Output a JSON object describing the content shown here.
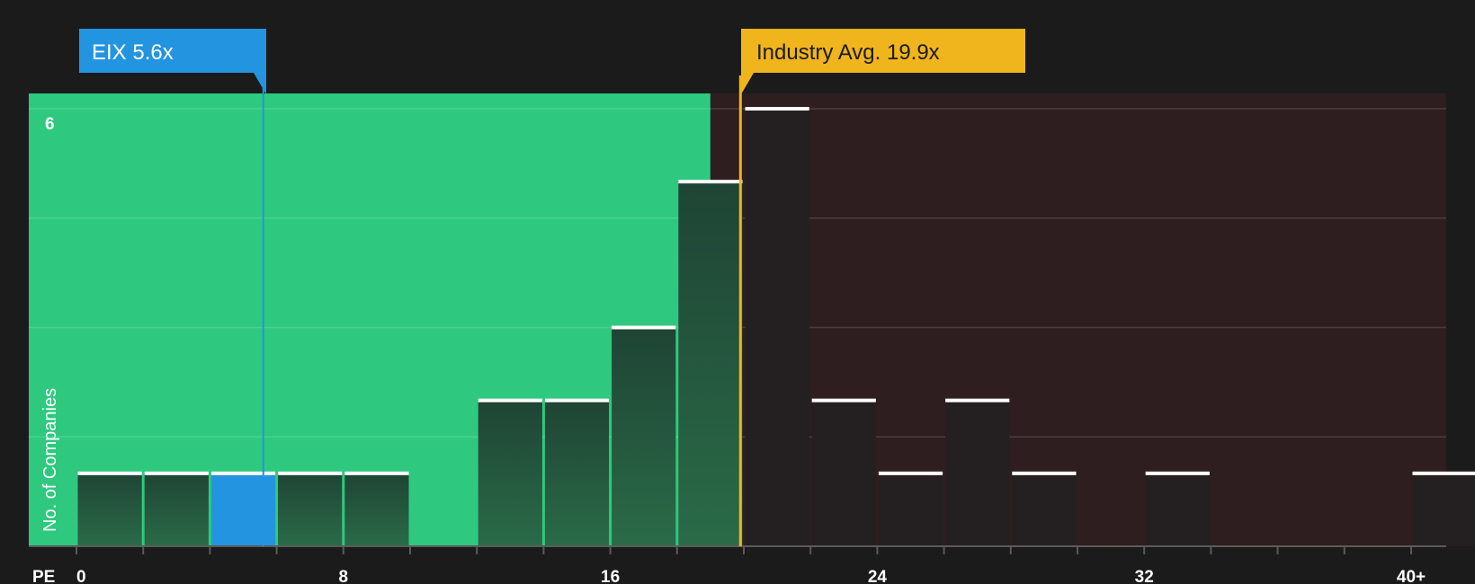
{
  "chart_data": {
    "type": "bar",
    "xlabel": "PE",
    "ylabel": "No. of Companies",
    "xlim": [
      0,
      41
    ],
    "ylim": [
      0,
      6.2
    ],
    "x_tick_labels": [
      {
        "x": 0,
        "label": "0"
      },
      {
        "x": 8,
        "label": "8"
      },
      {
        "x": 16,
        "label": "16"
      },
      {
        "x": 24,
        "label": "24"
      },
      {
        "x": 32,
        "label": "32"
      },
      {
        "x": 40,
        "label": "40+"
      }
    ],
    "minor_ticks": [
      0,
      2,
      4,
      6,
      8,
      10,
      12,
      14,
      16,
      18,
      20,
      22,
      24,
      26,
      28,
      30,
      32,
      34,
      36,
      38,
      40
    ],
    "y_ticks": [
      6
    ],
    "gridlines": [
      1.5,
      3,
      4.5,
      6
    ],
    "bins": [
      {
        "x0": 0,
        "x1": 2,
        "count": 1
      },
      {
        "x0": 2,
        "x1": 4,
        "count": 1
      },
      {
        "x0": 4,
        "x1": 6,
        "count": 1,
        "highlight": true
      },
      {
        "x0": 6,
        "x1": 8,
        "count": 1
      },
      {
        "x0": 8,
        "x1": 10,
        "count": 1
      },
      {
        "x0": 12,
        "x1": 14,
        "count": 2
      },
      {
        "x0": 14,
        "x1": 16,
        "count": 2
      },
      {
        "x0": 16,
        "x1": 18,
        "count": 3
      },
      {
        "x0": 18,
        "x1": 20,
        "count": 5
      },
      {
        "x0": 20,
        "x1": 22,
        "count": 6
      },
      {
        "x0": 22,
        "x1": 24,
        "count": 2
      },
      {
        "x0": 24,
        "x1": 26,
        "count": 1
      },
      {
        "x0": 26,
        "x1": 28,
        "count": 2
      },
      {
        "x0": 28,
        "x1": 30,
        "count": 1
      },
      {
        "x0": 32,
        "x1": 34,
        "count": 1
      },
      {
        "x0": 40,
        "x1": 42,
        "count": 1
      }
    ],
    "fair_value_upper": 19,
    "markers": {
      "company": {
        "label": "EIX 5.6x",
        "value": 5.6
      },
      "industry": {
        "label": "Industry Avg. 19.9x",
        "value": 19.9
      }
    }
  },
  "colors": {
    "background": "#1b1b1c",
    "good_zone": "#2ec97f",
    "bad_zone": "#2e1e1f",
    "bar_dark_top": "#1f4434",
    "bar_dark_bottom": "#2a6b48",
    "bar_bad": "#242021",
    "highlight": "#2394e0",
    "industry": "#f0b41c",
    "cap": "#ffffff",
    "axis": "#5a5a5a"
  }
}
